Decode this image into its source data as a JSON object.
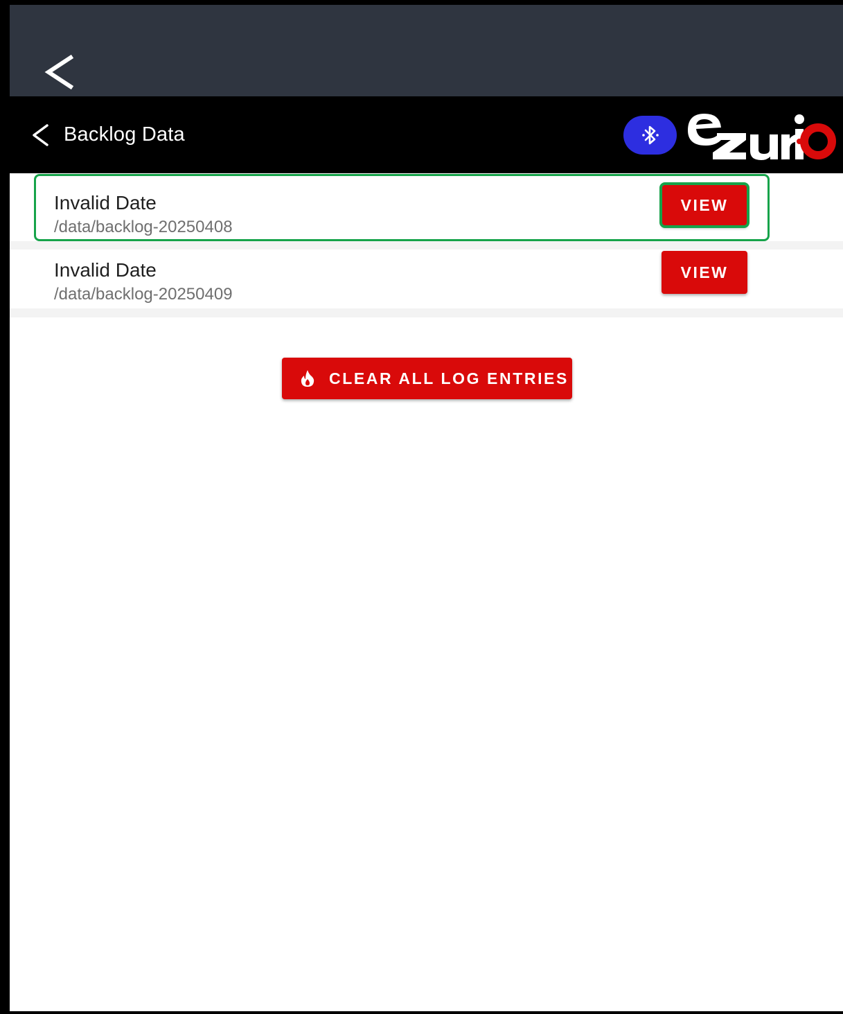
{
  "app": {
    "title": "Backlog Data",
    "brand": "ezurio"
  },
  "colors": {
    "status_bar": "#2f3540",
    "app_bar": "#000000",
    "accent_red": "#d90a0a",
    "bluetooth_blue": "#2d2ee0",
    "highlight_green": "#16a34a"
  },
  "icons": {
    "system_back": "chevron-left-icon",
    "app_back": "chevron-left-icon",
    "bluetooth": "bluetooth-icon",
    "clear": "fire-icon"
  },
  "backlog": {
    "entries": [
      {
        "title": "Invalid Date",
        "path": "/data/backlog-20250408",
        "action": "VIEW",
        "highlighted": true
      },
      {
        "title": "Invalid Date",
        "path": "/data/backlog-20250409",
        "action": "VIEW",
        "highlighted": false
      }
    ]
  },
  "actions": {
    "clear_all_label": "CLEAR ALL LOG ENTRIES"
  }
}
